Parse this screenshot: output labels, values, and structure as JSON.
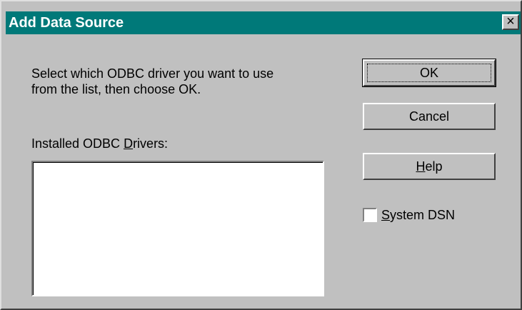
{
  "window": {
    "title": "Add Data Source",
    "close_glyph": "×"
  },
  "prompt": {
    "line1": "Select which ODBC driver you want to use",
    "line2": "from the list, then choose OK."
  },
  "drivers_list": {
    "label_prefix": "Installed ODBC ",
    "label_accel": "D",
    "label_suffix": "rivers:",
    "items": []
  },
  "buttons": {
    "ok": "OK",
    "cancel": "Cancel",
    "help_accel": "H",
    "help_rest": "elp"
  },
  "system_dsn": {
    "label_accel": "S",
    "label_rest": "ystem DSN",
    "checked": false
  }
}
